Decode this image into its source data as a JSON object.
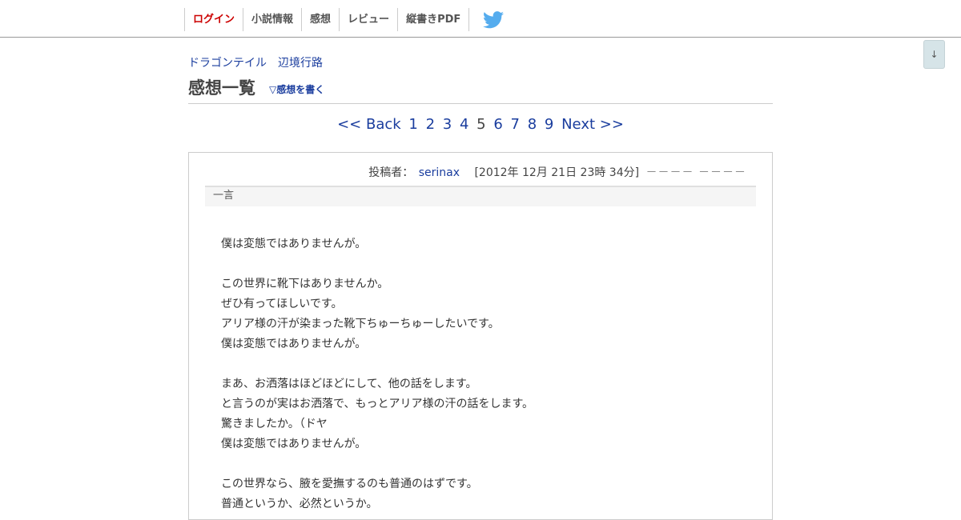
{
  "nav": {
    "items": [
      "ログイン",
      "小説情報",
      "感想",
      "レビュー",
      "縦書きPDF"
    ]
  },
  "scroll_button": "↓",
  "breadcrumb": [
    "ドラゴンテイル",
    "辺境行路"
  ],
  "page_title": "感想一覧",
  "write_link": "▽感想を書く",
  "pagination": {
    "back": "<< Back",
    "pages": [
      "1",
      "2",
      "3",
      "4",
      "5",
      "6",
      "7",
      "8",
      "9"
    ],
    "current": "5",
    "next": "Next >>"
  },
  "review": {
    "poster_label": "投稿者：",
    "author": "serinax",
    "date": "[2012年 12月 21日 23時 34分]",
    "stars": "－－－－ －－－－",
    "section_label": "一言",
    "lines": [
      "",
      "僕は変態ではありませんが。",
      "",
      "この世界に靴下はありませんか。",
      "ぜひ有ってほしいです。",
      "アリア様の汗が染まった靴下ちゅーちゅーしたいです。",
      "僕は変態ではありませんが。",
      "",
      "まあ、お洒落はほどほどにして、他の話をします。",
      "と言うのが実はお洒落で、もっとアリア様の汗の話をします。",
      "驚きましたか。（ドヤ",
      "僕は変態ではありませんが。",
      "",
      "この世界なら、腋を愛撫するのも普通のはずです。",
      "普通というか、必然というか。"
    ]
  },
  "colors": {
    "link": "#1a3d9e",
    "login_active": "#cc0000",
    "twitter": "#55acee"
  }
}
